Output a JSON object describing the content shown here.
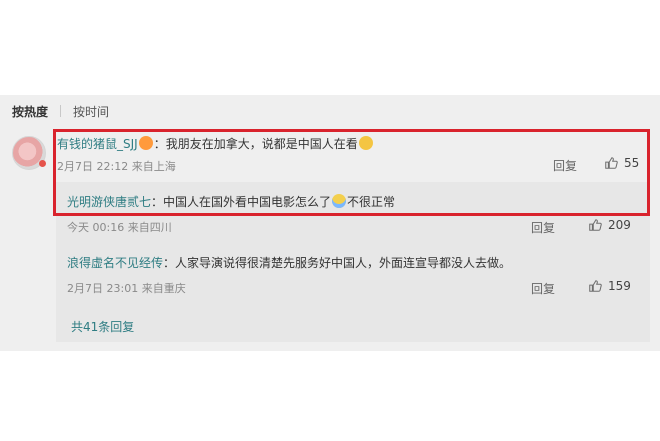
{
  "sort": {
    "active_label": "按热度",
    "inactive_label": "按时间"
  },
  "main_comment": {
    "username": "有钱的猪鼠_SJJ",
    "text": "：我朋友在加拿大，说都是中国人在看",
    "meta": "2月7日 22:12 来自上海",
    "reply_label": "回复",
    "likes": "55"
  },
  "replies": [
    {
      "username": "光明游侠唐贰七",
      "text": "：中国人在国外看中国电影怎么了",
      "text2": "不很正常",
      "meta": "今天 00:16 来自四川",
      "reply_label": "回复",
      "likes": "209"
    },
    {
      "username": "浪得虚名不见经传",
      "text": "：人家导演说得很清楚先服务好中国人，外面连宣导都没人去做。",
      "meta": "2月7日 23:01 来自重庆",
      "reply_label": "回复",
      "likes": "159"
    }
  ],
  "more_replies": "共41条回复",
  "colors": {
    "highlight": "#d9232d",
    "link": "#2f7d83",
    "panel_bg": "#efefef"
  },
  "icons": [
    "thumbs-up-icon",
    "emoji-icon"
  ]
}
